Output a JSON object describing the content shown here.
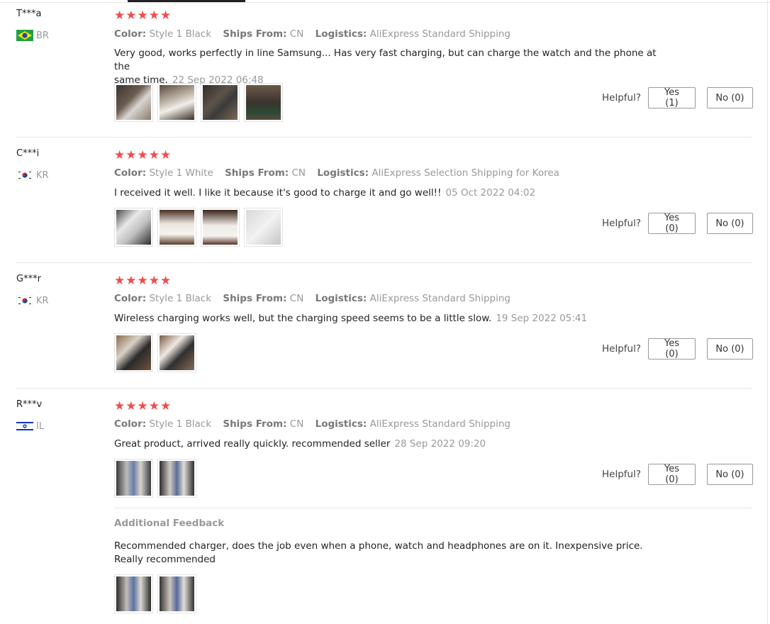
{
  "reviews": [
    {
      "user": "T***a",
      "country": "BR",
      "flag": "brazil-flag-icon",
      "rating": 5,
      "color_label": "Color:",
      "color": "Style 1 Black",
      "ships_label": "Ships From:",
      "ships": "CN",
      "logistics_label": "Logistics:",
      "logistics": "AliExpress Standard Shipping",
      "text_line1": "Very good, works perfectly in line Samsung... Has very fast charging, but can charge the watch and the phone at the",
      "text_line2": "same time.",
      "date": "22 Sep 2022 06:48",
      "helpful_label": "Helpful?",
      "yes": "Yes (1)",
      "no": "No (0)"
    },
    {
      "user": "C***i",
      "country": "KR",
      "flag": "korea-flag-icon",
      "rating": 5,
      "color_label": "Color:",
      "color": "Style 1 White",
      "ships_label": "Ships From:",
      "ships": "CN",
      "logistics_label": "Logistics:",
      "logistics": "AliExpress Selection Shipping for Korea",
      "text_line1": "I received it well. I like it because it's good to charge it and go well!!",
      "date": "05 Oct 2022 04:02",
      "helpful_label": "Helpful?",
      "yes": "Yes (0)",
      "no": "No (0)"
    },
    {
      "user": "G***r",
      "country": "KR",
      "flag": "korea-flag-icon",
      "rating": 5,
      "color_label": "Color:",
      "color": "Style 1 Black",
      "ships_label": "Ships From:",
      "ships": "CN",
      "logistics_label": "Logistics:",
      "logistics": "AliExpress Standard Shipping",
      "text_line1": "Wireless charging works well, but the charging speed seems to be a little slow.",
      "date": "19 Sep 2022 05:41",
      "helpful_label": "Helpful?",
      "yes": "Yes (0)",
      "no": "No (0)"
    },
    {
      "user": "R***v",
      "country": "IL",
      "flag": "israel-flag-icon",
      "rating": 5,
      "color_label": "Color:",
      "color": "Style 1 Black",
      "ships_label": "Ships From:",
      "ships": "CN",
      "logistics_label": "Logistics:",
      "logistics": "AliExpress Standard Shipping",
      "text_line1": "Great product, arrived really quickly. recommended seller",
      "date": "28 Sep 2022 09:20",
      "helpful_label": "Helpful?",
      "yes": "Yes (0)",
      "no": "No (0)",
      "additional": {
        "title": "Additional Feedback",
        "line1": "Recommended charger, does the job even when a phone, watch and headphones are on it. Inexpensive price.",
        "line2": "Really recommended"
      }
    }
  ],
  "star_glyph": "★★★★★",
  "colors": {
    "star": "#f04c4c",
    "muted": "#999999",
    "divider": "#e6e6e6"
  }
}
